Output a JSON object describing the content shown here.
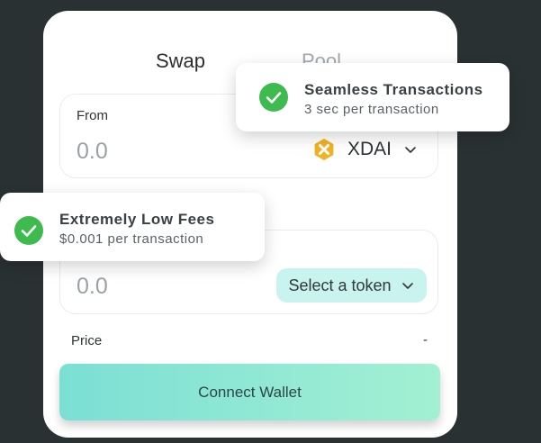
{
  "tabs": {
    "swap": "Swap",
    "pool": "Pool"
  },
  "from": {
    "label": "From",
    "amount": "0.0",
    "token": "XDAI",
    "token_icon": "xdai-icon"
  },
  "to": {
    "amount": "0.0",
    "select_label": "Select a token"
  },
  "price": {
    "label": "Price",
    "value": "-"
  },
  "connect_label": "Connect Wallet",
  "toasts": [
    {
      "title": "Seamless Transactions",
      "subtitle": "3 sec per transaction"
    },
    {
      "title": "Extremely Low Fees",
      "subtitle": "$0.001 per transaction"
    }
  ],
  "colors": {
    "background": "#2a3133",
    "accent_start": "#7bdfd4",
    "accent_end": "#a3f0d3",
    "select_bg": "#c9f3ee",
    "check_green": "#3dbb4f",
    "xdai_gold": "#f0b323"
  }
}
